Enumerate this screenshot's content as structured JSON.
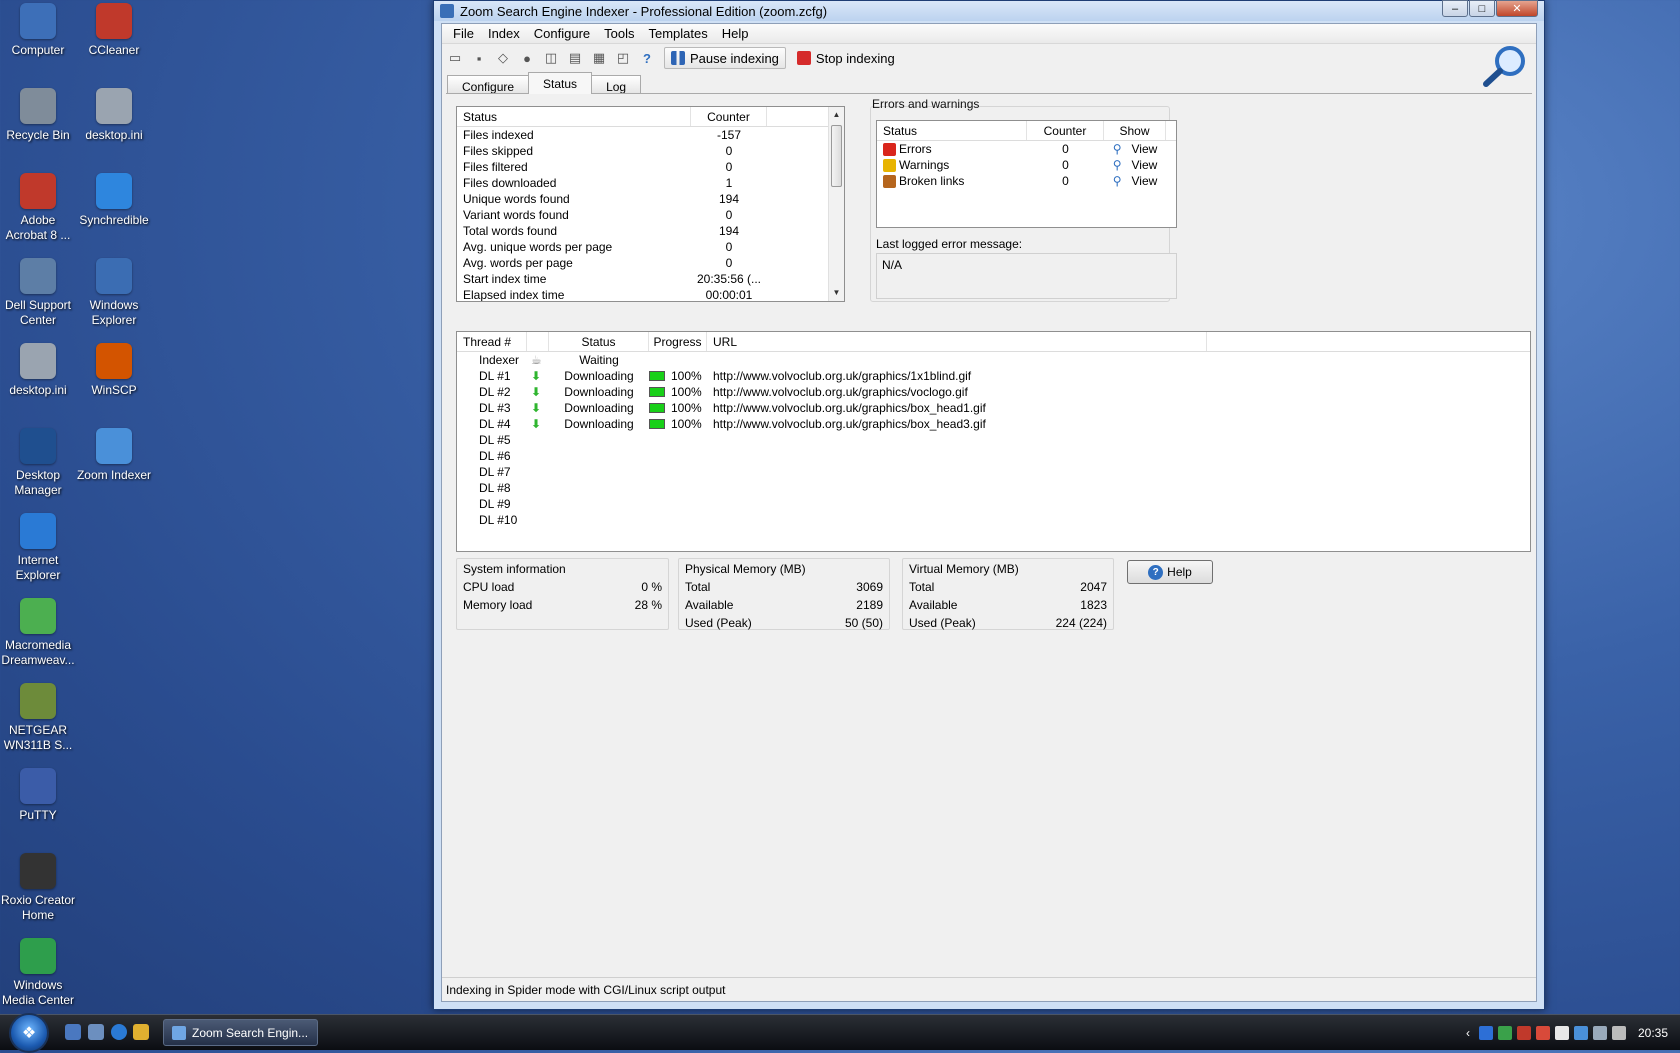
{
  "desktop": {
    "icons": [
      {
        "label": "Computer",
        "color": "#3d6fb8",
        "glyph": "computer-icon"
      },
      {
        "label": "CCleaner",
        "color": "#c0392b",
        "glyph": "ccleaner-icon"
      },
      {
        "label": "Recycle Bin",
        "color": "#7f8c9a",
        "glyph": "recycle-bin-icon"
      },
      {
        "label": "desktop.ini",
        "color": "#9aa4b0",
        "glyph": "settings-file-icon"
      },
      {
        "label": "Adobe Acrobat 8 ...",
        "color": "#c0392b",
        "glyph": "acrobat-icon"
      },
      {
        "label": "Synchredible",
        "color": "#2e86de",
        "glyph": "sync-icon"
      },
      {
        "label": "Dell Support Center",
        "color": "#5d7ea6",
        "glyph": "tools-icon"
      },
      {
        "label": "Windows Explorer",
        "color": "#3b6db3",
        "glyph": "explorer-icon"
      },
      {
        "label": "desktop.ini",
        "color": "#9aa4b0",
        "glyph": "settings-file-icon"
      },
      {
        "label": "WinSCP",
        "color": "#d35400",
        "glyph": "winscp-icon"
      },
      {
        "label": "Desktop Manager",
        "color": "#1f4f8f",
        "glyph": "blackberry-icon"
      },
      {
        "label": "Zoom Indexer",
        "color": "#4a90d9",
        "glyph": "magnifier-icon"
      },
      {
        "label": "Internet Explorer",
        "color": "#2a7ad5",
        "glyph": "ie-icon"
      },
      {
        "label": "Macromedia Dreamweav...",
        "color": "#4caf50",
        "glyph": "dreamweaver-icon"
      },
      {
        "label": "NETGEAR WN311B S...",
        "color": "#6d8b3a",
        "glyph": "wireless-icon"
      },
      {
        "label": "PuTTY",
        "color": "#3b5ca8",
        "glyph": "putty-icon"
      },
      {
        "label": "Roxio Creator Home",
        "color": "#333333",
        "glyph": "disc-icon"
      },
      {
        "label": "Windows Media Center",
        "color": "#2e9e4c",
        "glyph": "media-center-icon"
      }
    ]
  },
  "window": {
    "title": "Zoom Search Engine Indexer - Professional Edition (zoom.zcfg)",
    "buttons": {
      "minimize": "–",
      "maximize": "□",
      "close": "✕"
    }
  },
  "menu": [
    "File",
    "Index",
    "Configure",
    "Tools",
    "Templates",
    "Help"
  ],
  "toolbar": {
    "pause_label": "Pause indexing",
    "stop_label": "Stop indexing"
  },
  "tabs": [
    "Configure",
    "Status",
    "Log"
  ],
  "status_list": {
    "headers": {
      "status": "Status",
      "counter": "Counter"
    },
    "rows": [
      {
        "label": "Files indexed",
        "value": "-157"
      },
      {
        "label": "Files skipped",
        "value": "0"
      },
      {
        "label": "Files filtered",
        "value": "0"
      },
      {
        "label": "Files downloaded",
        "value": "1"
      },
      {
        "label": "Unique words found",
        "value": "194"
      },
      {
        "label": "Variant words found",
        "value": "0"
      },
      {
        "label": "Total words found",
        "value": "194"
      },
      {
        "label": "Avg. unique words per page",
        "value": "0"
      },
      {
        "label": "Avg. words per page",
        "value": "0"
      },
      {
        "label": "Start index time",
        "value": "20:35:56 (..."
      },
      {
        "label": "Elapsed index time",
        "value": "00:00:01"
      }
    ]
  },
  "errors": {
    "title": "Errors and warnings",
    "headers": {
      "status": "Status",
      "counter": "Counter",
      "show": "Show"
    },
    "rows": [
      {
        "label": "Errors",
        "counter": "0",
        "action": "View",
        "icon": "error-icon",
        "color": "#d9261c"
      },
      {
        "label": "Warnings",
        "counter": "0",
        "action": "View",
        "icon": "warning-icon",
        "color": "#e8b400"
      },
      {
        "label": "Broken links",
        "counter": "0",
        "action": "View",
        "icon": "broken-link-icon",
        "color": "#b5651d"
      }
    ],
    "last_error_label": "Last logged error message:",
    "last_error_value": "N/A"
  },
  "threads": {
    "headers": {
      "thread": "Thread #",
      "status": "Status",
      "progress": "Progress",
      "url": "URL"
    },
    "rows": [
      {
        "name": "Indexer",
        "status": "Waiting",
        "progress": "",
        "progress_value": null,
        "url": "",
        "icon": "indexer-icon"
      },
      {
        "name": "DL #1",
        "status": "Downloading",
        "progress": "100%",
        "progress_value": 1.0,
        "url": "http://www.volvoclub.org.uk/graphics/1x1blind.gif",
        "icon": "download-arrow-icon"
      },
      {
        "name": "DL #2",
        "status": "Downloading",
        "progress": "100%",
        "progress_value": 1.0,
        "url": "http://www.volvoclub.org.uk/graphics/voclogo.gif",
        "icon": "download-arrow-icon"
      },
      {
        "name": "DL #3",
        "status": "Downloading",
        "progress": "100%",
        "progress_value": 1.0,
        "url": "http://www.volvoclub.org.uk/graphics/box_head1.gif",
        "icon": "download-arrow-icon"
      },
      {
        "name": "DL #4",
        "status": "Downloading",
        "progress": "100%",
        "progress_value": 1.0,
        "url": "http://www.volvoclub.org.uk/graphics/box_head3.gif",
        "icon": "download-arrow-icon"
      },
      {
        "name": "DL #5",
        "status": "",
        "progress": "",
        "progress_value": null,
        "url": "",
        "icon": ""
      },
      {
        "name": "DL #6",
        "status": "",
        "progress": "",
        "progress_value": null,
        "url": "",
        "icon": ""
      },
      {
        "name": "DL #7",
        "status": "",
        "progress": "",
        "progress_value": null,
        "url": "",
        "icon": ""
      },
      {
        "name": "DL #8",
        "status": "",
        "progress": "",
        "progress_value": null,
        "url": "",
        "icon": ""
      },
      {
        "name": "DL #9",
        "status": "",
        "progress": "",
        "progress_value": null,
        "url": "",
        "icon": ""
      },
      {
        "name": "DL #10",
        "status": "",
        "progress": "",
        "progress_value": null,
        "url": "",
        "icon": ""
      }
    ]
  },
  "system_info": {
    "title": "System information",
    "cpu_label": "CPU load",
    "cpu_value": "0 %",
    "mem_label": "Memory load",
    "mem_value": "28 %"
  },
  "physical_memory": {
    "title": "Physical Memory (MB)",
    "total_label": "Total",
    "total": "3069",
    "avail_label": "Available",
    "available": "2189",
    "used_label": "Used (Peak)",
    "used": "50 (50)"
  },
  "virtual_memory": {
    "title": "Virtual Memory (MB)",
    "total_label": "Total",
    "total": "2047",
    "avail_label": "Available",
    "available": "1823",
    "used_label": "Used (Peak)",
    "used": "224 (224)"
  },
  "help_button": "Help",
  "statusbar": "Indexing in Spider mode with CGI/Linux script output",
  "taskbar": {
    "task_label": "Zoom Search Engin...",
    "clock": "20:35"
  },
  "colors": {
    "progress_green": "#19d019",
    "accent_blue": "#2f6fc0"
  }
}
